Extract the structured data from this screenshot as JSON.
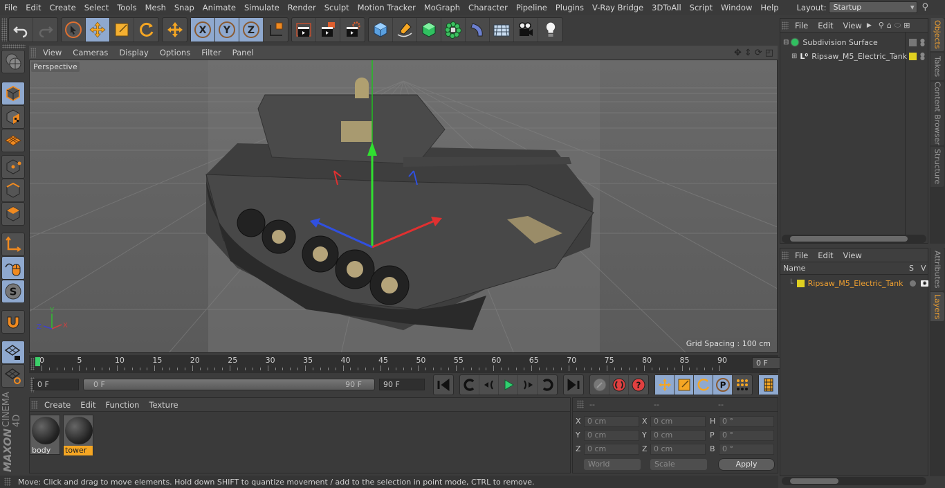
{
  "menubar": {
    "items": [
      "File",
      "Edit",
      "Create",
      "Select",
      "Tools",
      "Mesh",
      "Snap",
      "Animate",
      "Simulate",
      "Render",
      "Sculpt",
      "Motion Tracker",
      "MoGraph",
      "Character",
      "Pipeline",
      "Plugins",
      "V-Ray Bridge",
      "3DToAll",
      "Script",
      "Window",
      "Help"
    ],
    "layout_label": "Layout:",
    "layout_value": "Startup"
  },
  "toolbar": {
    "icons": [
      "undo-icon",
      "redo-icon",
      "live-selection-icon",
      "move-icon",
      "scale-icon",
      "rotate-icon",
      "recent-tool-icon",
      "x-axis-icon",
      "y-axis-icon",
      "z-axis-icon",
      "coordinate-system-icon",
      "render-view-icon",
      "render-picture-viewer-icon",
      "render-settings-icon",
      "cube-icon",
      "pen-icon",
      "subdivision-surface-icon",
      "cloner-icon",
      "deformer-icon",
      "floor-icon",
      "camera-icon",
      "light-icon"
    ]
  },
  "viewport": {
    "menu": [
      "View",
      "Cameras",
      "Display",
      "Options",
      "Filter",
      "Panel"
    ],
    "camera_label": "Perspective",
    "grid_spacing": "Grid Spacing : 100 cm",
    "axis_labels": {
      "x": "X",
      "y": "Y",
      "z": "Z"
    }
  },
  "timeline": {
    "ticks": [
      "0",
      "5",
      "10",
      "15",
      "20",
      "25",
      "30",
      "35",
      "40",
      "45",
      "50",
      "55",
      "60",
      "65",
      "70",
      "75",
      "80",
      "85",
      "90"
    ],
    "current_frame": "0 F",
    "start_field": "0 F",
    "range_start": "0 F",
    "range_end": "90 F",
    "end_field": "90 F"
  },
  "materials": {
    "menu": [
      "Create",
      "Edit",
      "Function",
      "Texture"
    ],
    "items": [
      {
        "name": "body",
        "selected": false
      },
      {
        "name": "tower",
        "selected": true
      }
    ]
  },
  "coordinates": {
    "headers": [
      "--",
      "--",
      "--"
    ],
    "rows": [
      {
        "l1": "X",
        "v1": "0 cm",
        "l2": "X",
        "v2": "0 cm",
        "l3": "H",
        "v3": "0 °"
      },
      {
        "l1": "Y",
        "v1": "0 cm",
        "l2": "Y",
        "v2": "0 cm",
        "l3": "P",
        "v3": "0 °"
      },
      {
        "l1": "Z",
        "v1": "0 cm",
        "l2": "Z",
        "v2": "0 cm",
        "l3": "B",
        "v3": "0 °"
      }
    ],
    "mode_dropdown": "World",
    "type_dropdown": "Scale",
    "apply_label": "Apply"
  },
  "status": {
    "text": "Move: Click and drag to move elements. Hold down SHIFT to quantize movement / add to the selection in point mode, CTRL to remove."
  },
  "objects_panel": {
    "menu": [
      "File",
      "Edit",
      "View"
    ],
    "objects": [
      {
        "name": "Subdivision Surface",
        "icon": "subdivision-surface-icon"
      },
      {
        "name": "Ripsaw_M5_Electric_Tank",
        "icon": "null-object-icon"
      }
    ]
  },
  "layers_panel": {
    "menu": [
      "File",
      "Edit",
      "View"
    ],
    "columns": [
      "Name",
      "S",
      "V"
    ],
    "layers": [
      {
        "name": "Ripsaw_M5_Electric_Tank",
        "color": "#e0d020"
      }
    ]
  },
  "side_tabs_top": [
    {
      "label": "Objects",
      "active": true
    },
    {
      "label": "Takes",
      "active": false
    },
    {
      "label": "Content Browser",
      "active": false
    },
    {
      "label": "Structure",
      "active": false
    }
  ],
  "side_tabs_bottom": [
    {
      "label": "Attributes",
      "active": false
    },
    {
      "label": "Layers",
      "active": true
    }
  ],
  "brand": {
    "maxon": "MAXON",
    "product": "CINEMA 4D"
  },
  "colors": {
    "accent_orange": "#f5a623",
    "active_blue": "#8fa9cf",
    "timeline_marker": "#3ccf6a"
  }
}
